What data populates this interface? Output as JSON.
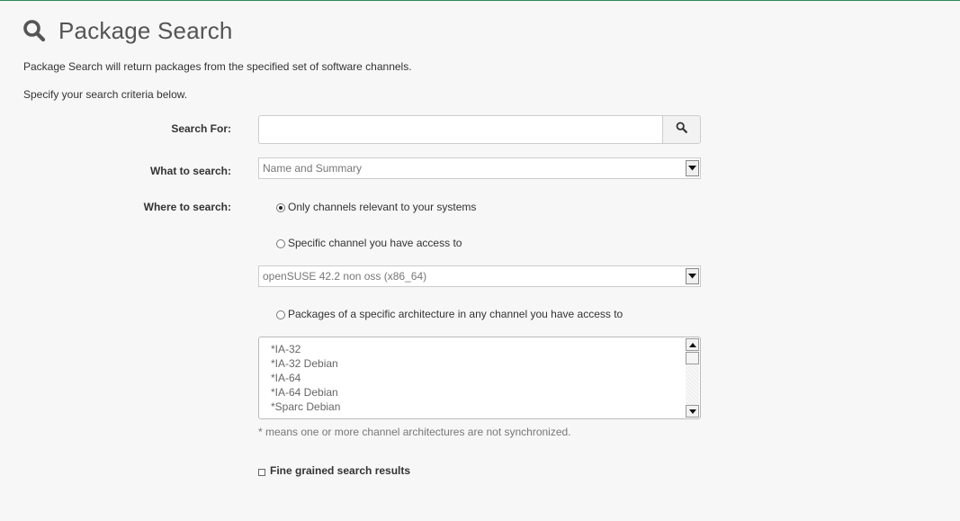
{
  "page": {
    "title": "Package Search",
    "intro_line1": "Package Search will return packages from the specified set of software channels.",
    "intro_line2": "Specify your search criteria below.",
    "header_icon": "search-icon"
  },
  "form": {
    "search_for": {
      "label": "Search For:",
      "value": "",
      "placeholder": "",
      "button_icon": "search-icon"
    },
    "what_to_search": {
      "label": "What to search:",
      "selected": "Name and Summary"
    },
    "where_to_search": {
      "label": "Where to search:",
      "options": [
        {
          "label": "Only channels relevant to your systems",
          "checked": true
        },
        {
          "label": "Specific channel you have access to",
          "checked": false
        },
        {
          "label": "Packages of a specific architecture in any channel you have access to",
          "checked": false
        }
      ],
      "channel_select": "openSUSE 42.2 non oss (x86_64)",
      "architectures": [
        "*IA-32",
        "*IA-32 Debian",
        "*IA-64",
        "*IA-64 Debian",
        "*Sparc Debian"
      ],
      "note": "* means one or more channel architectures are not synchronized."
    },
    "fine_grained": {
      "label": "Fine grained search results",
      "checked": false
    }
  },
  "colors": {
    "accent_border": "#2e8b57",
    "background": "#f7f7f7"
  }
}
